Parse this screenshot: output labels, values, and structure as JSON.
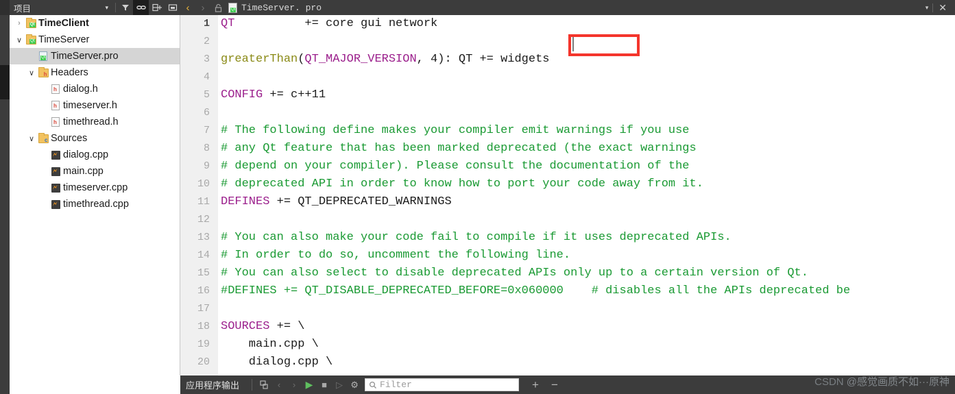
{
  "sidebar": {
    "toolbar": {
      "combo_label": "项目",
      "combo_caret": "▾",
      "icons": [
        {
          "name": "filter-icon",
          "glyph": "∇"
        },
        {
          "name": "link-icon",
          "glyph": "⚭"
        },
        {
          "name": "split-add-icon",
          "glyph": "⊞"
        },
        {
          "name": "collapse-icon",
          "glyph": "▣"
        }
      ]
    },
    "tree": [
      {
        "label": "TimeClient",
        "depth": 0,
        "twisty": "›",
        "state": "collapsed",
        "icon": "qt-project-folder-icon",
        "bold": true,
        "selected": false
      },
      {
        "label": "TimeServer",
        "depth": 0,
        "twisty": "∨",
        "state": "expanded",
        "icon": "qt-project-folder-icon",
        "bold": false,
        "selected": false
      },
      {
        "label": "TimeServer.pro",
        "depth": 1,
        "twisty": "",
        "state": "leaf",
        "icon": "qt-pro-file-icon",
        "bold": false,
        "selected": true
      },
      {
        "label": "Headers",
        "depth": 1,
        "twisty": "∨",
        "state": "expanded",
        "icon": "headers-folder-icon",
        "bold": false,
        "selected": false
      },
      {
        "label": "dialog.h",
        "depth": 2,
        "twisty": "",
        "state": "leaf",
        "icon": "header-file-icon",
        "bold": false,
        "selected": false
      },
      {
        "label": "timeserver.h",
        "depth": 2,
        "twisty": "",
        "state": "leaf",
        "icon": "header-file-icon",
        "bold": false,
        "selected": false
      },
      {
        "label": "timethread.h",
        "depth": 2,
        "twisty": "",
        "state": "leaf",
        "icon": "header-file-icon",
        "bold": false,
        "selected": false
      },
      {
        "label": "Sources",
        "depth": 1,
        "twisty": "∨",
        "state": "expanded",
        "icon": "sources-folder-icon",
        "bold": false,
        "selected": false
      },
      {
        "label": "dialog.cpp",
        "depth": 2,
        "twisty": "",
        "state": "leaf",
        "icon": "cpp-file-icon",
        "bold": false,
        "selected": false
      },
      {
        "label": "main.cpp",
        "depth": 2,
        "twisty": "",
        "state": "leaf",
        "icon": "cpp-file-icon",
        "bold": false,
        "selected": false
      },
      {
        "label": "timeserver.cpp",
        "depth": 2,
        "twisty": "",
        "state": "leaf",
        "icon": "cpp-file-icon",
        "bold": false,
        "selected": false
      },
      {
        "label": "timethread.cpp",
        "depth": 2,
        "twisty": "",
        "state": "leaf",
        "icon": "cpp-file-icon",
        "bold": false,
        "selected": false
      }
    ]
  },
  "editor_toolbar": {
    "back_glyph": "‹",
    "forward_glyph": "›",
    "lock_glyph": "⚿",
    "tab_filename": "TimeServer. pro",
    "dropdown_caret": "▾",
    "close_glyph": "✕"
  },
  "editor": {
    "highlight_word": "network",
    "highlight_color": "#f4352c",
    "lines": [
      {
        "n": "1",
        "current": true,
        "tokens": [
          {
            "t": "QT",
            "c": "var"
          },
          {
            "t": "          += core gui network",
            "c": "plain"
          }
        ]
      },
      {
        "n": "2",
        "current": false,
        "tokens": []
      },
      {
        "n": "3",
        "current": false,
        "tokens": [
          {
            "t": "greaterThan",
            "c": "func"
          },
          {
            "t": "(",
            "c": "plain"
          },
          {
            "t": "QT_MAJOR_VERSION",
            "c": "var"
          },
          {
            "t": ", 4): QT += widgets",
            "c": "plain"
          }
        ]
      },
      {
        "n": "4",
        "current": false,
        "tokens": []
      },
      {
        "n": "5",
        "current": false,
        "tokens": [
          {
            "t": "CONFIG",
            "c": "var"
          },
          {
            "t": " += c++11",
            "c": "plain"
          }
        ]
      },
      {
        "n": "6",
        "current": false,
        "tokens": []
      },
      {
        "n": "7",
        "current": false,
        "tokens": [
          {
            "t": "# The following define makes your compiler emit warnings if you use",
            "c": "comment"
          }
        ]
      },
      {
        "n": "8",
        "current": false,
        "tokens": [
          {
            "t": "# any Qt feature that has been marked deprecated (the exact warnings",
            "c": "comment"
          }
        ]
      },
      {
        "n": "9",
        "current": false,
        "tokens": [
          {
            "t": "# depend on your compiler). Please consult the documentation of the",
            "c": "comment"
          }
        ]
      },
      {
        "n": "10",
        "current": false,
        "tokens": [
          {
            "t": "# deprecated API in order to know how to port your code away from it.",
            "c": "comment"
          }
        ]
      },
      {
        "n": "11",
        "current": false,
        "tokens": [
          {
            "t": "DEFINES",
            "c": "var"
          },
          {
            "t": " += QT_DEPRECATED_WARNINGS",
            "c": "plain"
          }
        ]
      },
      {
        "n": "12",
        "current": false,
        "tokens": []
      },
      {
        "n": "13",
        "current": false,
        "tokens": [
          {
            "t": "# You can also make your code fail to compile if it uses deprecated APIs.",
            "c": "comment"
          }
        ]
      },
      {
        "n": "14",
        "current": false,
        "tokens": [
          {
            "t": "# In order to do so, uncomment the following line.",
            "c": "comment"
          }
        ]
      },
      {
        "n": "15",
        "current": false,
        "tokens": [
          {
            "t": "# You can also select to disable deprecated APIs only up to a certain version of Qt.",
            "c": "comment"
          }
        ]
      },
      {
        "n": "16",
        "current": false,
        "tokens": [
          {
            "t": "#DEFINES += QT_DISABLE_DEPRECATED_BEFORE=0x060000    # disables all the APIs deprecated be",
            "c": "comment"
          }
        ]
      },
      {
        "n": "17",
        "current": false,
        "tokens": []
      },
      {
        "n": "18",
        "current": false,
        "tokens": [
          {
            "t": "SOURCES",
            "c": "var"
          },
          {
            "t": " += \\",
            "c": "plain"
          }
        ]
      },
      {
        "n": "19",
        "current": false,
        "tokens": [
          {
            "t": "    main.cpp \\",
            "c": "plain"
          }
        ]
      },
      {
        "n": "20",
        "current": false,
        "tokens": [
          {
            "t": "    dialog.cpp \\",
            "c": "plain"
          }
        ]
      }
    ]
  },
  "bottom_bar": {
    "title": "应用程序输出",
    "icons": [
      {
        "name": "attach-process-icon",
        "glyph": "⭳"
      },
      {
        "name": "prev-item-icon",
        "glyph": "‹"
      },
      {
        "name": "next-item-icon",
        "glyph": "›"
      },
      {
        "name": "run-icon",
        "glyph": "▶"
      },
      {
        "name": "stop-icon",
        "glyph": "■"
      },
      {
        "name": "rerun-icon",
        "glyph": "▷"
      },
      {
        "name": "settings-gear-icon",
        "glyph": "⚙"
      }
    ],
    "filter_placeholder": "Filter",
    "search_glyph": "⚲",
    "maximize_glyph": "+",
    "minimize_glyph": "−"
  },
  "watermark": {
    "prefix": "CSDN ",
    "text": "@感觉画质不如···原神"
  }
}
